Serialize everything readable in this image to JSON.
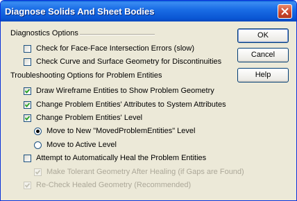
{
  "window": {
    "title": "Diagnose Solids And Sheet Bodies"
  },
  "diagnostics": {
    "label": "Diagnostics Options",
    "options": [
      {
        "label": "Check for Face-Face Intersection Errors (slow)",
        "checked": false
      },
      {
        "label": "Check Curve and Surface Geometry for Discontinuities",
        "checked": false
      }
    ]
  },
  "troubleshooting": {
    "label": "Troubleshooting Options for Problem Entities",
    "draw_wireframe": {
      "label": "Draw Wireframe Entities to Show Problem Geometry",
      "checked": true
    },
    "change_attributes": {
      "label": "Change Problem Entities' Attributes to System Attributes",
      "checked": true
    },
    "change_level": {
      "label": "Change Problem Entities' Level",
      "checked": true
    },
    "move_new_level": {
      "label": "Move to New \"MovedProblemEntities\" Level",
      "selected": true
    },
    "move_active_level": {
      "label": "Move to Active Level",
      "selected": false
    },
    "auto_heal": {
      "label": "Attempt to Automatically Heal the Problem Entities",
      "checked": false
    },
    "tolerant_geometry": {
      "label": "Make Tolerant Geometry After Healing (if Gaps are Found)",
      "checked": true,
      "disabled": true
    },
    "recheck_healed": {
      "label": "Re-Check Healed Geometry (Recommended)",
      "checked": true,
      "disabled": true
    }
  },
  "buttons": {
    "ok": "OK",
    "cancel": "Cancel",
    "help": "Help"
  }
}
